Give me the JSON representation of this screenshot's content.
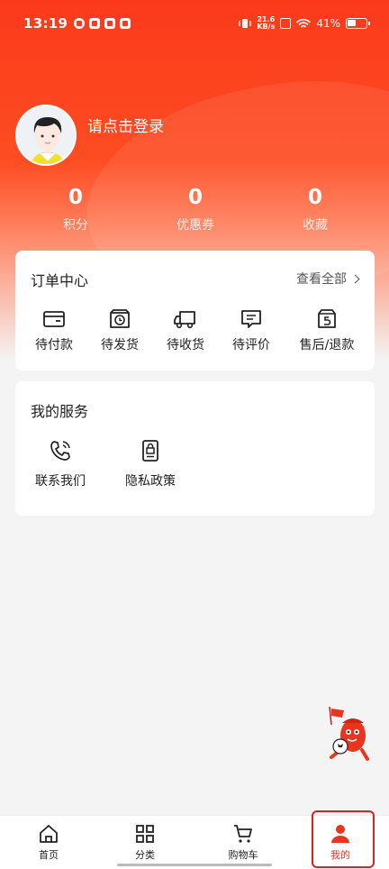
{
  "status_bar": {
    "time": "13:19",
    "net_speed_value": "21.6",
    "net_speed_unit": "KB/s",
    "battery": "41%"
  },
  "profile": {
    "login_prompt": "请点击登录"
  },
  "stats": [
    {
      "value": "0",
      "label": "积分"
    },
    {
      "value": "0",
      "label": "优惠券"
    },
    {
      "value": "0",
      "label": "收藏"
    }
  ],
  "orders": {
    "title": "订单中心",
    "view_all": "查看全部",
    "items": [
      {
        "label": "待付款",
        "icon": "wallet-icon"
      },
      {
        "label": "待发货",
        "icon": "package-clock-icon"
      },
      {
        "label": "待收货",
        "icon": "truck-icon"
      },
      {
        "label": "待评价",
        "icon": "comment-icon"
      },
      {
        "label": "售后/退款",
        "icon": "return-box-icon"
      }
    ]
  },
  "services": {
    "title": "我的服务",
    "items": [
      {
        "label": "联系我们",
        "icon": "phone-icon"
      },
      {
        "label": "隐私政策",
        "icon": "privacy-lock-icon"
      }
    ]
  },
  "nav": {
    "items": [
      {
        "label": "首页",
        "icon": "home-icon"
      },
      {
        "label": "分类",
        "icon": "grid-icon"
      },
      {
        "label": "购物车",
        "icon": "cart-icon"
      },
      {
        "label": "我的",
        "icon": "user-icon"
      }
    ],
    "active_color": "#e8361e"
  },
  "colors": {
    "brand_red": "#fb3a1b",
    "background": "#f4f4f4"
  }
}
